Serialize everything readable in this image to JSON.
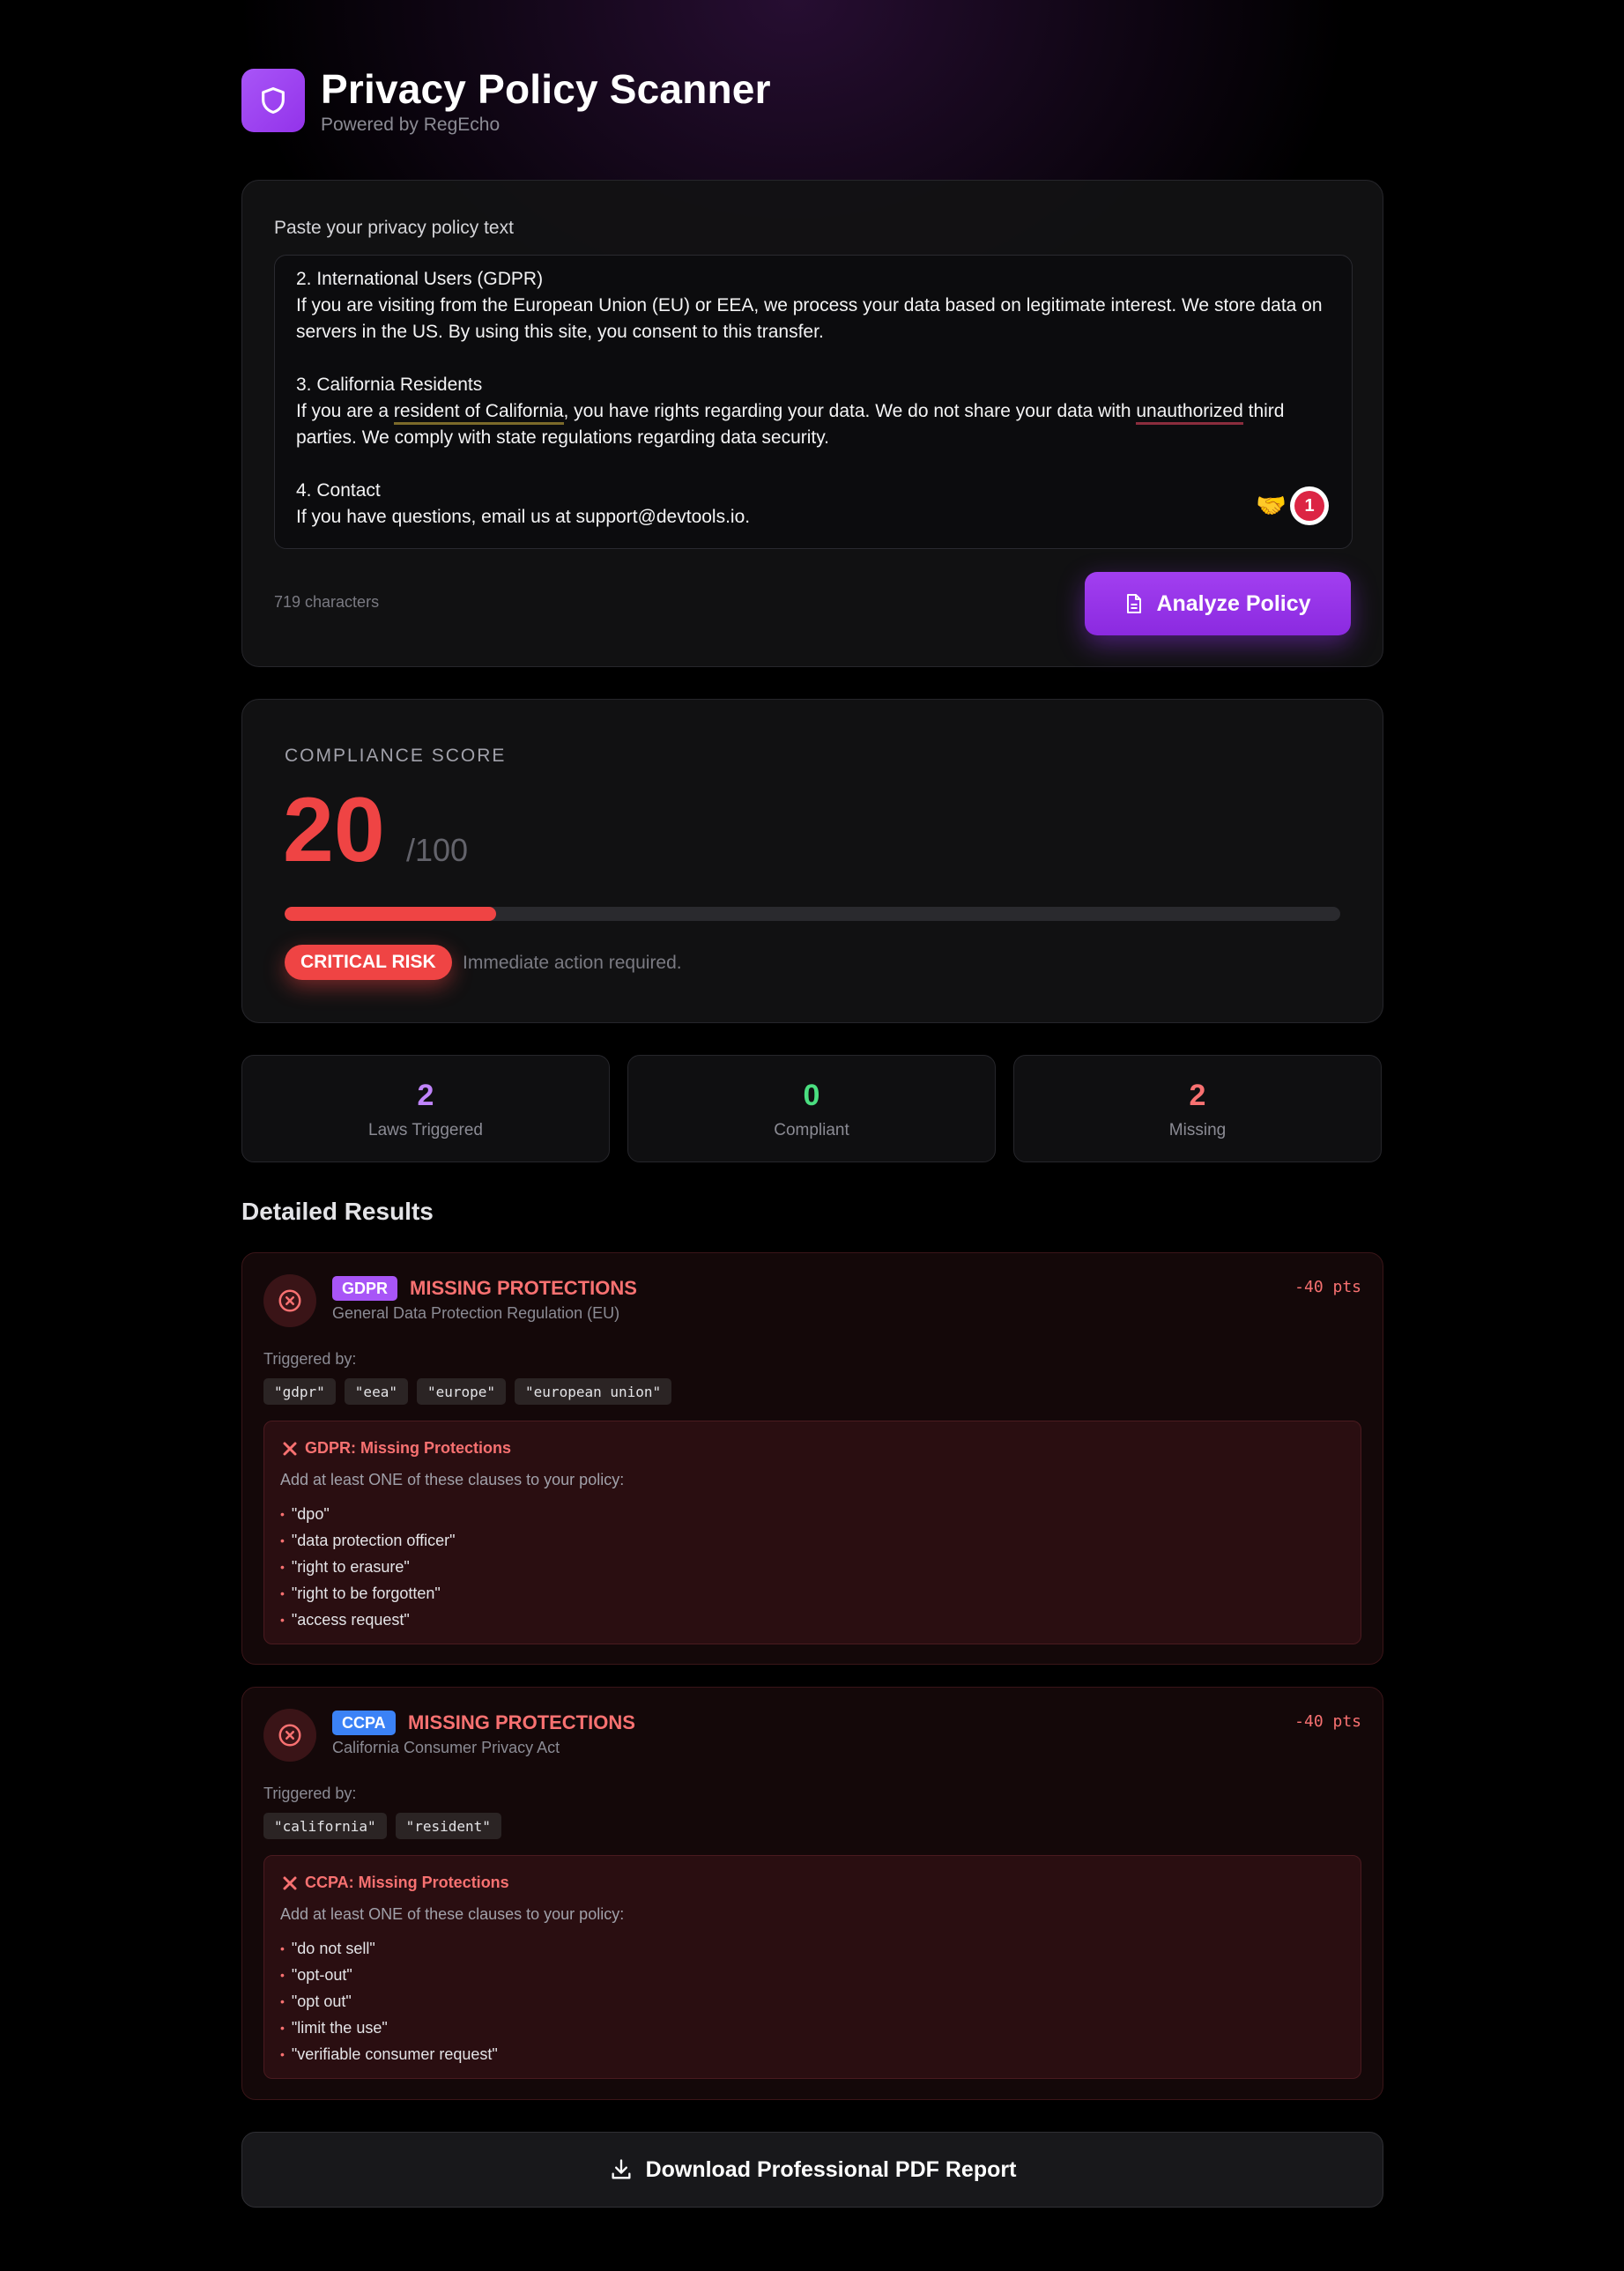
{
  "header": {
    "title": "Privacy Policy Scanner",
    "subtitle": "Powered by RegEcho",
    "logo_icon": "shield-icon"
  },
  "input": {
    "label": "Paste your privacy policy text",
    "lines": {
      "l1": "2. International Users (GDPR)",
      "l2": "If you are visiting from the European Union (EU) or EEA, we process your data based on legitimate interest. We store data on servers in the US. By using this site, you consent to this transfer.",
      "l3": "3. California Residents",
      "l4a": "If you are a ",
      "l4b": "resident of California",
      "l4c": ", you have rights regarding your data. We do not share your data with ",
      "l4d": "unauthorized",
      "l4e": " third parties. We comply with state regulations regarding data security.",
      "l5": "4. Contact",
      "l6": "If you have questions, email us at support@devtools.io."
    },
    "notification_count": "1",
    "char_count": "719 characters",
    "analyze_label": "Analyze Policy"
  },
  "score": {
    "label": "COMPLIANCE SCORE",
    "value": "20",
    "max": "/100",
    "fraction": 0.2,
    "risk_badge": "CRITICAL RISK",
    "risk_text": "Immediate action required.",
    "color": "#ef4444"
  },
  "stats": [
    {
      "value": "2",
      "label": "Laws Triggered",
      "color": "#c084fc"
    },
    {
      "value": "0",
      "label": "Compliant",
      "color": "#4ade80"
    },
    {
      "value": "2",
      "label": "Missing",
      "color": "#f87171"
    }
  ],
  "results_title": "Detailed Results",
  "results": [
    {
      "badge": "GDPR",
      "badge_color": "#a855f7",
      "status": "MISSING PROTECTIONS",
      "subtitle": "General Data Protection Regulation (EU)",
      "points": "-40 pts",
      "triggered_label": "Triggered by:",
      "triggers": [
        "\"gdpr\"",
        "\"eea\"",
        "\"europe\"",
        "\"european union\""
      ],
      "advice_title": "GDPR: Missing Protections",
      "advice_sub": "Add at least ONE of these clauses to your policy:",
      "clauses": [
        "\"dpo\"",
        "\"data protection officer\"",
        "\"right to erasure\"",
        "\"right to be forgotten\"",
        "\"access request\""
      ]
    },
    {
      "badge": "CCPA",
      "badge_color": "#3b82f6",
      "status": "MISSING PROTECTIONS",
      "subtitle": "California Consumer Privacy Act",
      "points": "-40 pts",
      "triggered_label": "Triggered by:",
      "triggers": [
        "\"california\"",
        "\"resident\""
      ],
      "advice_title": "CCPA: Missing Protections",
      "advice_sub": "Add at least ONE of these clauses to your policy:",
      "clauses": [
        "\"do not sell\"",
        "\"opt-out\"",
        "\"opt out\"",
        "\"limit the use\"",
        "\"verifiable consumer request\""
      ]
    }
  ],
  "download_label": "Download Professional PDF Report"
}
